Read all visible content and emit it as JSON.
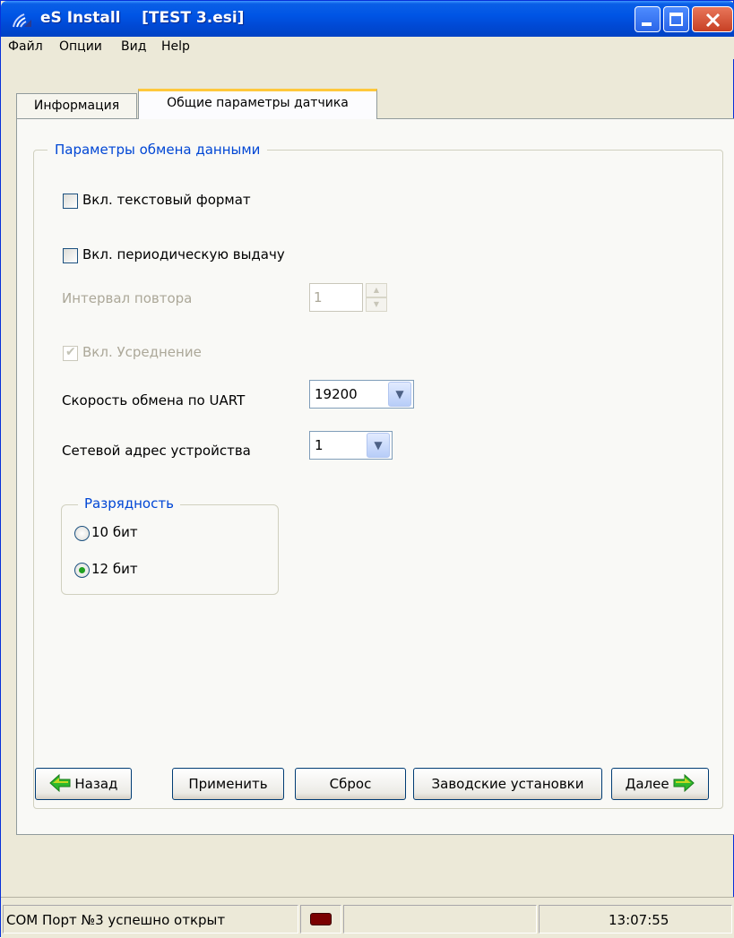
{
  "window": {
    "title": "eS Install    [TEST 3.esi]",
    "icon": "signal-waves-icon"
  },
  "menu": [
    "Файл",
    "Опции",
    "Вид",
    "Help"
  ],
  "tabs": [
    {
      "label": "Информация"
    },
    {
      "label": "Общие параметры датчика"
    }
  ],
  "group": {
    "legend": "Параметры обмена данными",
    "text_format_label": "Вкл. текстовый формат",
    "text_format_checked": false,
    "periodic_label": "Вкл. периодическую выдачу",
    "periodic_checked": false,
    "interval_label": "Интервал повтора",
    "interval_value": "1",
    "averaging_label": "Вкл. Усреднение",
    "averaging_checked": true,
    "uart_label": "Скорость обмена по UART",
    "uart_value": "19200",
    "address_label": "Сетевой адрес устройства",
    "address_value": "1"
  },
  "resolution": {
    "legend": "Разрядность",
    "options": [
      "10 бит",
      "12 бит"
    ],
    "selected": "12 бит"
  },
  "buttons": {
    "back": "Назад",
    "apply": "Применить",
    "reset": "Сброс",
    "factory": "Заводские установки",
    "next": "Далее"
  },
  "status": {
    "message": "COM Порт №3 успешно открыт",
    "time": "13:07:55",
    "led_color": "#7a0000"
  },
  "colors": {
    "titlebar": "#0055e5",
    "group_legend": "#0046d5",
    "active_tab_accent": "#ffc83c",
    "arrow_green": "#2db82d",
    "arrow_yellow": "#e8e020"
  }
}
